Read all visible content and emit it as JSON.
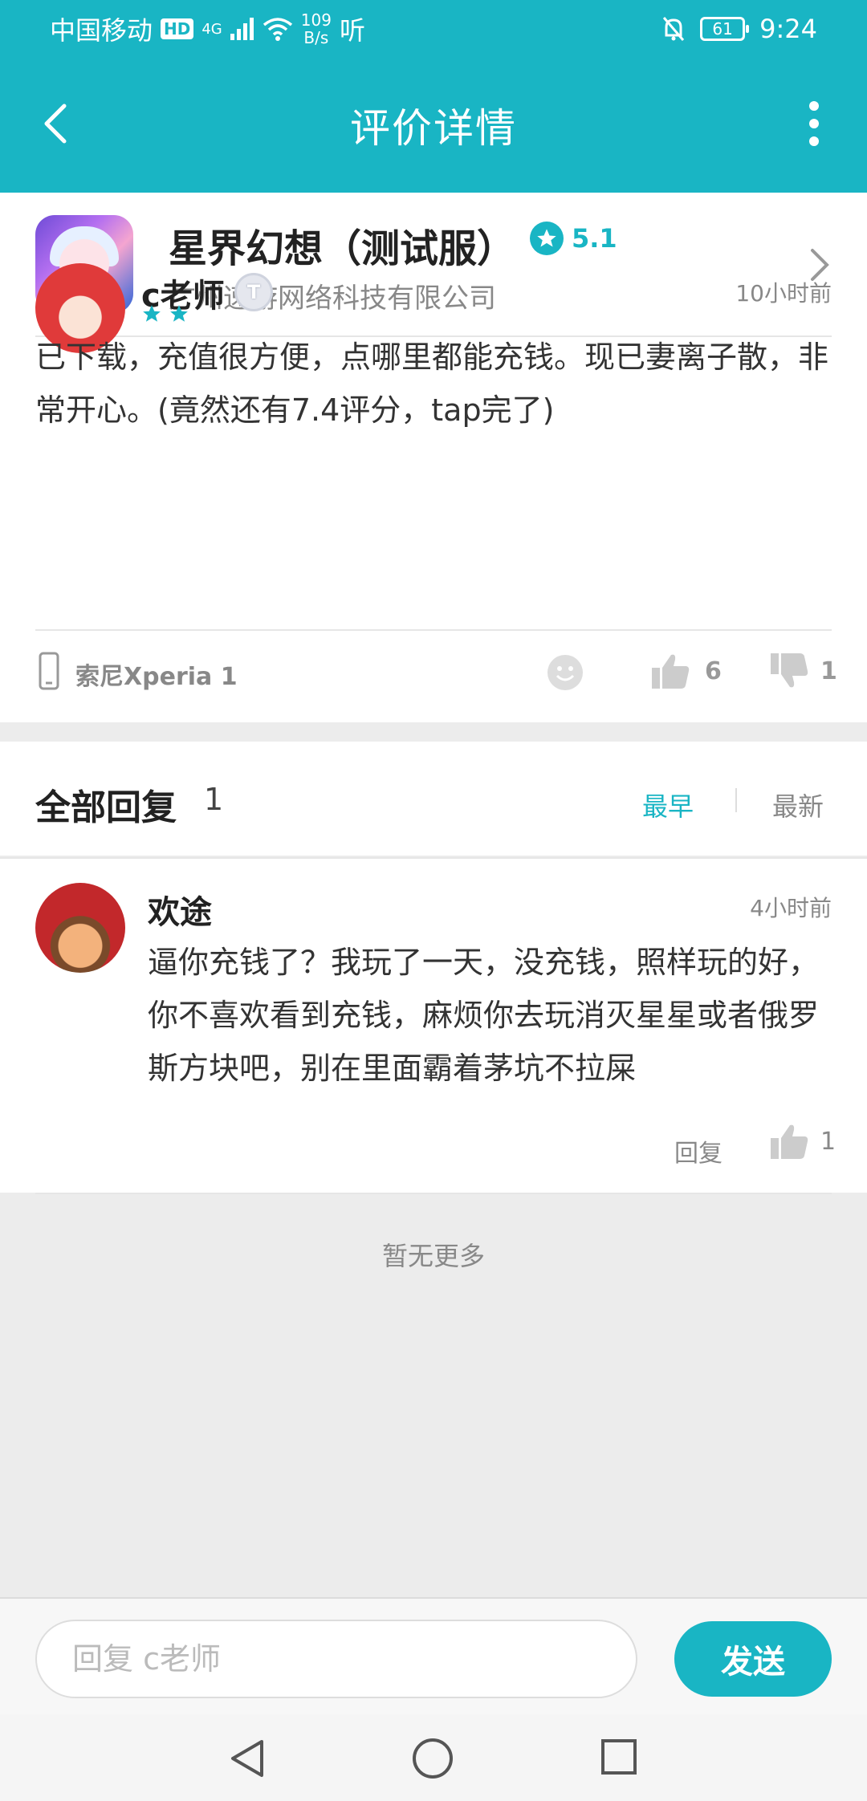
{
  "status": {
    "carrier": "中国移动",
    "hd": "HD",
    "net": "4G",
    "speed_value": "109",
    "speed_unit": "B/s",
    "extra": "听",
    "battery": "61",
    "time": "9:24"
  },
  "header": {
    "title": "评价详情"
  },
  "app": {
    "name": "星界幻想（测试服）",
    "rating": "5.1",
    "developer": "广州速游网络科技有限公司"
  },
  "review": {
    "user": "c老师",
    "level": "T",
    "time": "10小时前",
    "stars": 2,
    "text": "已下载，充值很方便，点哪里都能充钱。现已妻离子散，非常开心。(竟然还有7.4评分，tap完了)",
    "device": "索尼Xperia 1",
    "likes": "6",
    "dislikes": "1"
  },
  "replies": {
    "title": "全部回复",
    "count": "1",
    "sort_earliest": "最早",
    "sort_latest": "最新",
    "items": [
      {
        "user": "欢途",
        "time": "4小时前",
        "text": "逼你充钱了？我玩了一天，没充钱，照样玩的好，你不喜欢看到充钱，麻烦你去玩消灭星星或者俄罗斯方块吧，别在里面霸着茅坑不拉屎",
        "reply_label": "回复",
        "likes": "1"
      }
    ],
    "no_more": "暂无更多"
  },
  "composer": {
    "placeholder": "回复 c老师",
    "send_label": "发送"
  },
  "colors": {
    "accent": "#19b5c4"
  }
}
